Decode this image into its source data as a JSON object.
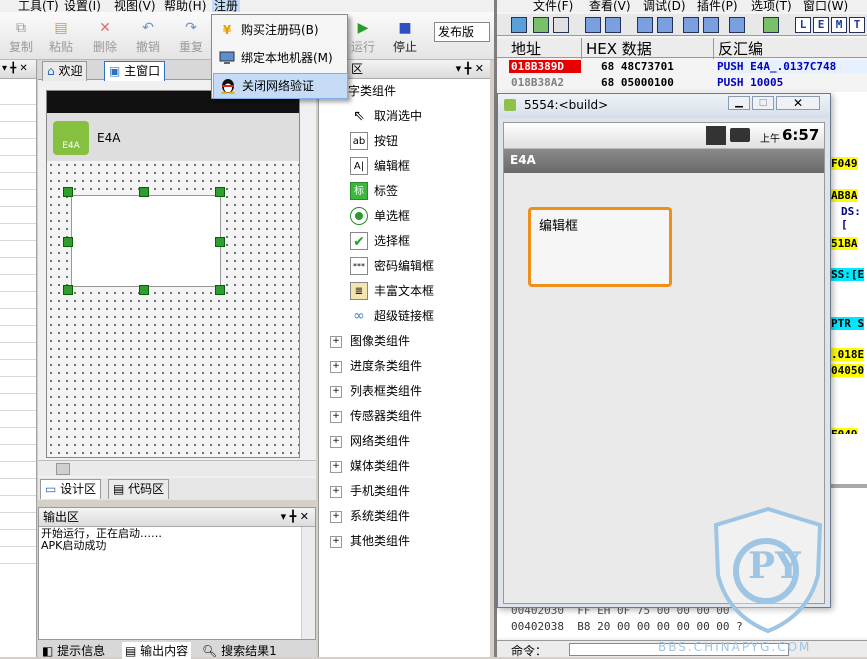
{
  "menubar": {
    "items": [
      "工具(T)",
      "设置(I)",
      "视图(V)",
      "帮助(H)",
      "注册"
    ]
  },
  "toolbar": {
    "buttons": [
      {
        "label": "复制",
        "icon": "copy-icon"
      },
      {
        "label": "粘贴",
        "icon": "paste-icon"
      },
      {
        "label": "删除",
        "icon": "delete-icon"
      },
      {
        "label": "撤销",
        "icon": "undo-icon"
      },
      {
        "label": "重复",
        "icon": "redo-icon"
      }
    ],
    "run_label": "运行",
    "stop_label": "停止",
    "release_label": "发布版"
  },
  "register_menu": {
    "items": [
      {
        "label": "购买注册码(B)",
        "icon": "yen-icon"
      },
      {
        "label": "绑定本地机器(M)",
        "icon": "computer-icon"
      },
      {
        "label": "关闭网络验证",
        "icon": "qq-penguin-icon"
      }
    ]
  },
  "doc_tabs": {
    "welcome": "欢迎",
    "main": "主窗口"
  },
  "design": {
    "app_title": "E4A",
    "logo_text": "E4A"
  },
  "bottom_tabs": {
    "design": "设计区",
    "code": "代码区"
  },
  "output": {
    "title": "输出区",
    "lines": [
      "开始运行，正在启动……",
      "APK启动成功"
    ]
  },
  "status_tabs": [
    "提示信息",
    "输出内容",
    "搜索结果1"
  ],
  "components": {
    "header": "文字类组件",
    "items": [
      "取消选中",
      "按钮",
      "编辑框",
      "标签",
      "单选框",
      "选择框",
      "密码编辑框",
      "丰富文本框",
      "超级链接框"
    ],
    "groups": [
      "图像类组件",
      "进度条类组件",
      "列表框类组件",
      "传感器类组件",
      "网络类组件",
      "媒体类组件",
      "手机类组件",
      "系统类组件",
      "其他类组件"
    ]
  },
  "debugger": {
    "menu": [
      "文件(F)",
      "查看(V)",
      "调试(D)",
      "插件(P)",
      "选项(T)",
      "窗口(W)"
    ],
    "toolbar_letters": [
      "L",
      "E",
      "M",
      "T"
    ],
    "columns": {
      "address": "地址",
      "hex": "HEX 数据",
      "disasm": "反汇编"
    },
    "rows": [
      {
        "address": "018B389D",
        "hex": "68 48C73701",
        "disasm": "PUSH E4A_.0137C748"
      },
      {
        "address": "018B38A2",
        "hex": "68 05000100",
        "disasm": "PUSH 10005"
      }
    ],
    "right_fragments": [
      "F049",
      "AB8A",
      "DS:[",
      "51BA",
      "SS:[E",
      "PTR S",
      ".018E",
      "04050",
      "F049"
    ],
    "bottom_rows": [
      {
        "address": "00402030",
        "hex": "FF EH 0F 75 00 00 00 00"
      },
      {
        "address": "00402038",
        "hex": "B8 20 00 00 00 00 00 00 ?"
      }
    ],
    "command_label": "命令："
  },
  "emulator": {
    "title": "5554:<build>",
    "time": "6:57",
    "ampm": "上午",
    "app_title": "E4A",
    "edit_text": "编辑框"
  },
  "watermark": {
    "text": "BBS.CHINAPYG.COM",
    "logo": "PY"
  }
}
